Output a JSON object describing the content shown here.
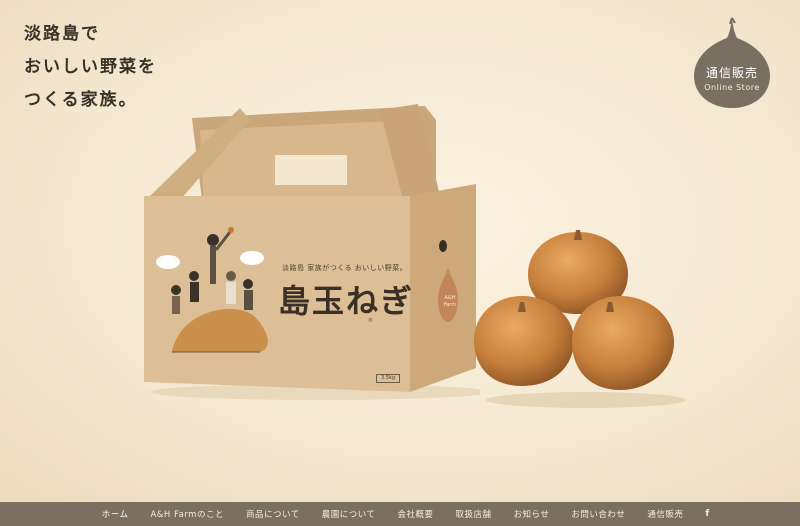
{
  "hero": {
    "tagline": [
      "淡路島で",
      "おいしい野菜を",
      "つくる家族。"
    ]
  },
  "store_badge": {
    "label_ja": "通信販売",
    "label_en": "Online Store",
    "color": "#7a7062"
  },
  "product_box": {
    "caption": "淡路島 家族がつくる おいしい野菜。",
    "brand": "島玉ねぎ",
    "brand_mark": "®",
    "weight": "3.5kg",
    "side_logo": "A&H Farm",
    "box_color": "#d9b98f"
  },
  "nav": {
    "items": [
      {
        "label": "ホーム",
        "active": true
      },
      {
        "label": "A&H Farmのこと"
      },
      {
        "label": "商品について"
      },
      {
        "label": "農園について"
      },
      {
        "label": "会社概要"
      },
      {
        "label": "取扱店舗"
      },
      {
        "label": "お知らせ"
      },
      {
        "label": "お問い合わせ"
      },
      {
        "label": "通信販売"
      }
    ],
    "facebook_icon": "f",
    "bar_color": "#7b705f"
  }
}
